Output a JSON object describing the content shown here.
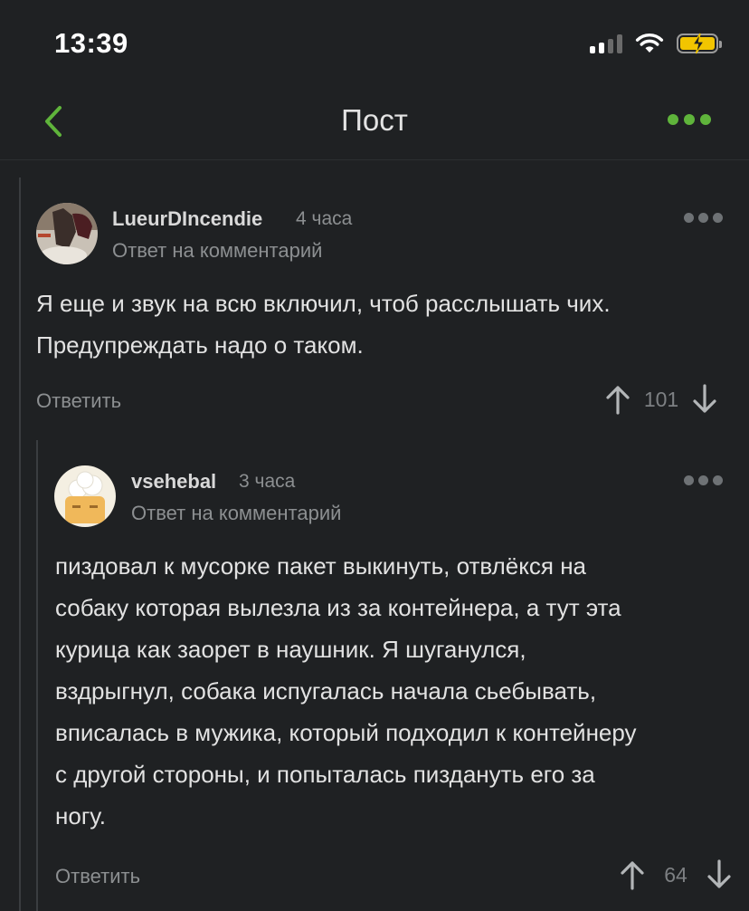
{
  "status_bar": {
    "time": "13:39",
    "icons": [
      "cellular-signal-icon",
      "wifi-icon",
      "battery-charging-icon"
    ],
    "battery_color": "#f2c500"
  },
  "nav": {
    "back_icon": "chevron-left-icon",
    "title": "Пост",
    "more_icon": "more-dots-icon",
    "accent_color": "#5fb43b"
  },
  "comments": [
    {
      "username": "LueurDIncendie",
      "time": "4 часа",
      "reply_note": "Ответ на комментарий",
      "text_lines": [
        "Я еще и звук на всю включил, чтоб расслышать чих.",
        "Предупреждать надо о таком."
      ],
      "reply_label": "Ответить",
      "rating": "101"
    },
    {
      "username": "vsehebal",
      "time": "3 часа",
      "reply_note": "Ответ на комментарий",
      "text_lines": [
        "пиздовал к мусорке пакет выкинуть, отвлёкся на",
        "собаку которая вылезла из за контейнера, а тут эта",
        "курица как заорет в наушник. Я шуганулся,",
        "вздрыгнул, собака испугалась начала сьебывать,",
        "вписалась в мужика, который подходил к контейнеру",
        "с другой стороны, и попыталась пиздануть его за",
        "ногу."
      ],
      "reply_label": "Ответить",
      "rating": "64"
    }
  ]
}
